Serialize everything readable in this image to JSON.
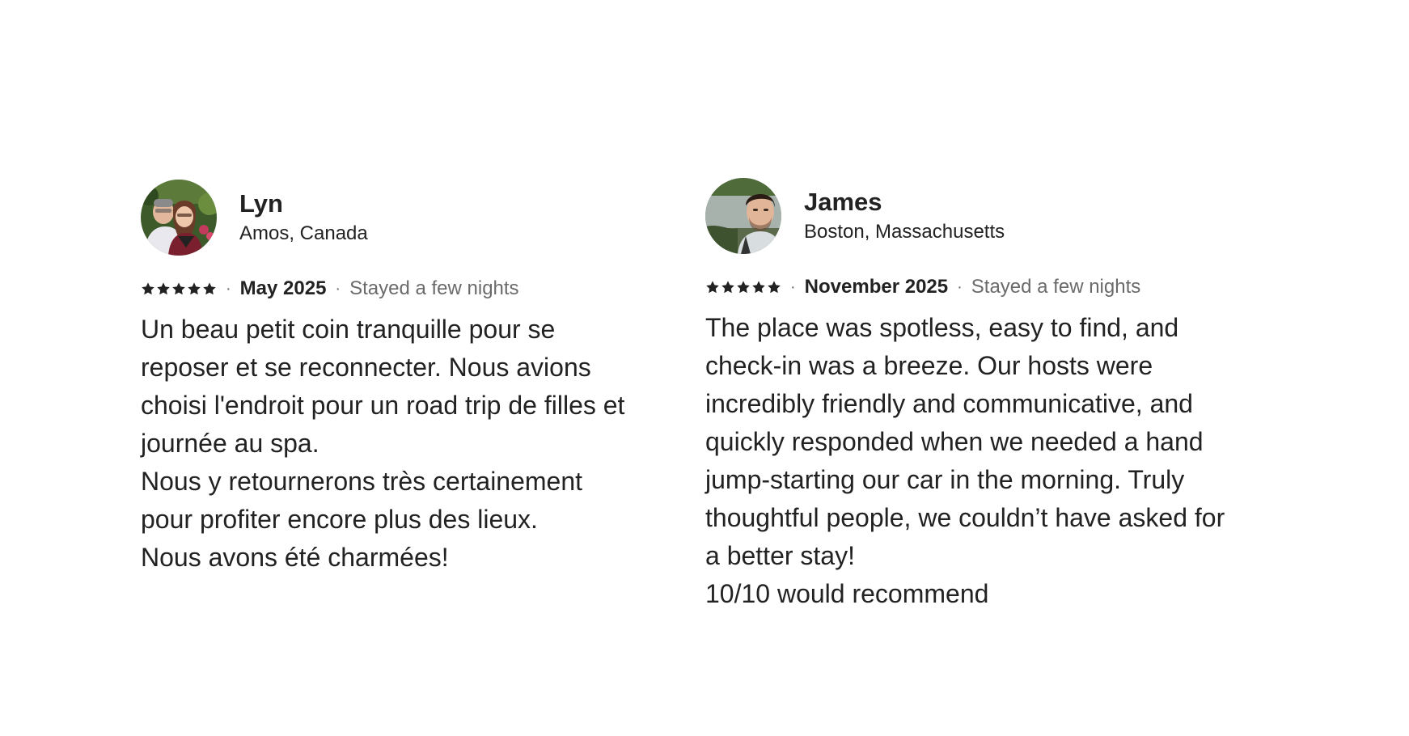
{
  "reviews": [
    {
      "name": "Lyn",
      "location": "Amos, Canada",
      "rating": 5,
      "date": "May 2025",
      "stay": "Stayed a few nights",
      "text": [
        "Un beau petit coin tranquille pour se reposer et se reconnecter. Nous avions choisi l'endroit pour un road trip de filles et journée au spa.",
        "Nous y retournerons très certainement pour profiter encore plus des lieux.",
        "Nous avons été charmées!"
      ]
    },
    {
      "name": "James",
      "location": "Boston, Massachusetts",
      "rating": 5,
      "date": "November 2025",
      "stay": "Stayed a few nights",
      "text": [
        "The place was spotless, easy to find, and check-in was a breeze. Our hosts were incredibly friendly and communicative, and quickly responded when we needed a hand jump-starting our car in the morning. Truly thoughtful people, we couldn’t have asked for a better stay!",
        "10/10 would recommend"
      ]
    }
  ],
  "separator": "·",
  "icons": {
    "star": "star-icon",
    "avatar": "avatar"
  },
  "colors": {
    "text": "#222222",
    "muted": "#6a6a6a",
    "background": "#ffffff"
  }
}
